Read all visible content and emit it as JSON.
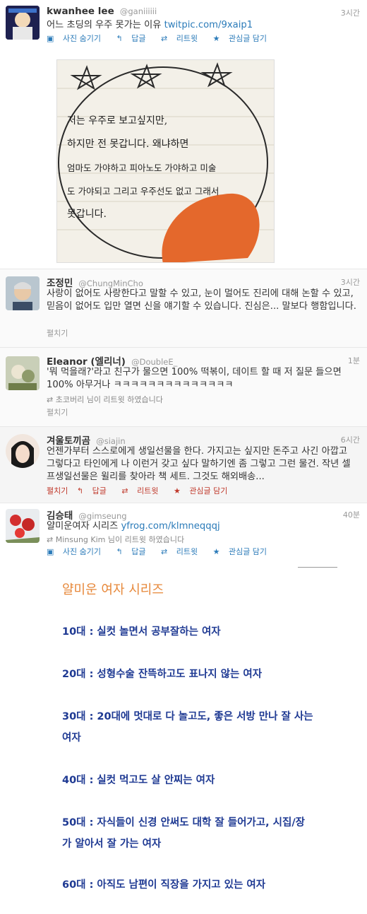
{
  "tweets": [
    {
      "name": "kwanhee lee",
      "handle": "@ganiiiiii",
      "time": "3시간",
      "text": "어느 초딩의 우주 못가는 이유 ",
      "link": "twitpic.com/9xaip1",
      "actions": {
        "hide_photo": "사진 숨기기",
        "reply": "답글",
        "retweet": "리트윗",
        "favorite": "관심글 담기"
      }
    },
    {
      "name": "조정민",
      "handle": "@ChungMinCho",
      "time": "3시간",
      "text": "사랑이 없어도 사랑한다고 말할 수 있고, 눈이 멀어도 진리에 대해 논할 수 있고, 믿음이 없어도 입만 열면 신을 얘기할 수 있습니다. 진심은... 말보다 행함입니다.",
      "fold": "펼치기"
    },
    {
      "name": "Eleanor (엘리너)",
      "handle": "@DoubleE_",
      "time": "1분",
      "text": "'뭐 먹을래?'라고 친구가 물으면 100% 떡볶이, 데이트 할 때 저 질문 들으면 100% 아무거나 ㅋㅋㅋㅋㅋㅋㅋㅋㅋㅋㅋㅋㅋㅋ",
      "retweet_by": "초코버리 님이 리트윗 하였습니다",
      "fold": "펼치기"
    },
    {
      "name": "겨울토끼곰",
      "handle": "@siajin",
      "time": "6시간",
      "text": "언젠가부터 스스로에게 생일선물을 한다. 가지고는 싶지만 돈주고 사긴 아깝고 그렇다고 타인에게 나 이런거 갖고 싶다 말하기엔 좀 그렇고 그런 물건. 작년 셀프생일선물은 윌리를 찾아라 책 세트. 그것도 해외배송...",
      "actions": {
        "fold": "펼치기",
        "reply": "답글",
        "retweet": "리트윗",
        "favorite": "관심글 담기"
      }
    },
    {
      "name": "김승태",
      "handle": "@gimseung",
      "time": "40분",
      "text": "얄미운여자 시리즈 ",
      "link": "yfrog.com/klmneqqqj",
      "retweet_by": "Minsung Kim 님이 리트윗 하였습니다",
      "actions": {
        "hide_photo": "사진 숨기기",
        "reply": "답글",
        "retweet": "리트윗",
        "favorite": "관심글 담기"
      }
    }
  ],
  "photo_note": {
    "lines": [
      "저는 우주로 보고싶지만,",
      "하지만 전 못갑니다. 왜냐하면",
      "엄마도 가야하고 피아노도 가야하고 미술",
      "도 가야되고 그리고 우주선도 없고 그래서",
      "못갑니다."
    ]
  },
  "series": {
    "title": "얄미운 여자 시리즈",
    "items": [
      "10대 : 실컷 놀면서 공부잘하는 여자",
      "20대 : 성형수술 잔뜩하고도 표나지 않는 여자",
      "30대 : 20대에 멋대로 다 놀고도, 좋은 서방 만나 잘 사는",
      "여자",
      "40대 : 실컷 먹고도 살 안찌는 여자",
      "50대 : 자식들이 신경 안써도 대학 잘 들어가고, 시집/장",
      "가 알아서 잘 가는 여자",
      "60대 : 아직도 남편이 직장을 가지고 있는 여자"
    ]
  },
  "colors": {
    "link": "#2b7bb9",
    "series_title": "#e7883a",
    "series_text": "#1f3a93"
  }
}
